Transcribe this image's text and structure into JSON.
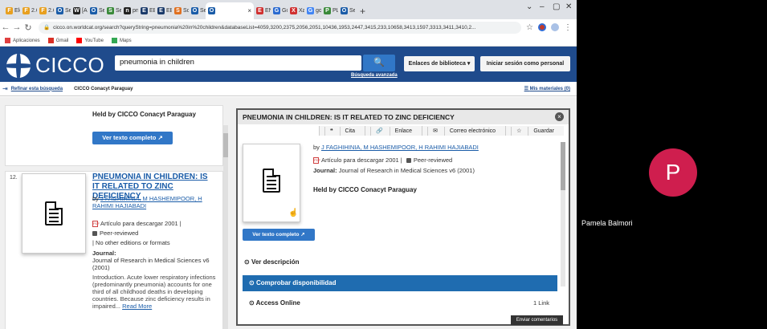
{
  "browser": {
    "tabs": [
      {
        "label": "Ele",
        "color": "#e8a020",
        "glyph": "F"
      },
      {
        "label": "2.6",
        "color": "#e8a020",
        "glyph": "F"
      },
      {
        "label": "2.6",
        "color": "#e8a020",
        "glyph": "F"
      },
      {
        "label": "Sea",
        "color": "#1a5ca8",
        "glyph": "O"
      },
      {
        "label": "[Ab",
        "color": "#222",
        "glyph": "W"
      },
      {
        "label": "Sea",
        "color": "#1a5ca8",
        "glyph": "O"
      },
      {
        "label": "Sea",
        "color": "#3a8a3a",
        "glyph": "S"
      },
      {
        "label": "pne",
        "color": "#222",
        "glyph": "n"
      },
      {
        "label": "EBS",
        "color": "#1a3a6a",
        "glyph": "E"
      },
      {
        "label": "EBS",
        "color": "#1a3a6a",
        "glyph": "E"
      },
      {
        "label": "Sci",
        "color": "#e07020",
        "glyph": "S"
      },
      {
        "label": "Sea",
        "color": "#1a5ca8",
        "glyph": "O"
      },
      {
        "label": "",
        "color": "#1a5ca8",
        "glyph": "O",
        "active": true
      },
      {
        "label": "ENI",
        "color": "#d03030",
        "glyph": "E"
      },
      {
        "label": "Go",
        "color": "#2a6ad0",
        "glyph": "G"
      },
      {
        "label": "Xal",
        "color": "#d03030",
        "glyph": "X"
      },
      {
        "label": "goc",
        "color": "#4285f4",
        "glyph": "G"
      },
      {
        "label": "PLC",
        "color": "#3a8a3a",
        "glyph": "P"
      },
      {
        "label": "Sea",
        "color": "#1a5ca8",
        "glyph": "O"
      }
    ],
    "new_tab": "+",
    "url": "cicco.on.worldcat.org/search?queryString=pneumonia%20in%20children&databaseList=4059,3200,2375,2056,2051,10436,1953,2447,3415,233,10658,3413,1597,3313,3411,3410,2...",
    "bookmarks": [
      {
        "label": "Aplicaciones",
        "color": "#e04040"
      },
      {
        "label": "Gmail",
        "color": "#d93025"
      },
      {
        "label": "YouTube",
        "color": "#ff0000"
      },
      {
        "label": "Maps",
        "color": "#34a853"
      }
    ]
  },
  "site": {
    "logo_text": "CICCO",
    "search_value": "pneumonia in children",
    "advanced_search": "Búsqueda avanzada",
    "links_btn": "Enlaces de biblioteca",
    "login_btn": "Iniciar sesión como personal",
    "refine_link": "Refinar esta búsqueda",
    "institution": "CICCO Conacyt Paraguay",
    "my_materials": "Mis materiales (0)"
  },
  "results": {
    "first_held": "Held by CICCO Conacyt Paraguay",
    "view_full_text": "Ver texto completo",
    "item_number": "12.",
    "title": "PNEUMONIA IN CHILDREN: IS IT RELATED TO ZINC DEFICIENCY",
    "by": "by",
    "authors_line1": "J FAGHIHINIA, M HASHEMIPOOR, H",
    "authors_line2": "RAHIMI HAJIABADI",
    "format": "Artículo para descargar 2001 |",
    "peer": "Peer-reviewed",
    "editions": "| No other editions or formats",
    "journal_label": "Journal:",
    "journal": "Journal of Research in Medical Sciences v6 (2001)",
    "abstract": "Introduction. Acute lower respiratory infections (predominantly pneumonia) accounts for one third of all childhood deaths in developing countries. Because zinc deficiency results in impaired...",
    "read_more": "Read More"
  },
  "detail": {
    "title": "PNEUMONIA IN CHILDREN: IS IT RELATED TO ZINC DEFICIENCY",
    "tools": [
      "Cita",
      "Enlace",
      "Correo electrónico",
      "Guardar"
    ],
    "authors": "J FAGHIHINIA, M HASHEMIPOOR, H RAHIMI HAJIABADI",
    "format": "Artículo para descargar 2001 |",
    "peer": "Peer-reviewed",
    "journal_label": "Journal:",
    "journal": "Journal of Research in Medical Sciences v6 (2001)",
    "held": "Held by CICCO Conacyt Paraguay",
    "full_text_btn": "Ver texto completo",
    "ver_descripcion": "Ver descripción",
    "comprobar": "Comprobar disponibilidad",
    "access_online": "Access Online",
    "one_link": "1 Link",
    "tooltip": "Enviar comentarios"
  },
  "participant": {
    "initial": "P",
    "name": "Pamela Balmori",
    "avatar_color": "#cf1e4e"
  }
}
